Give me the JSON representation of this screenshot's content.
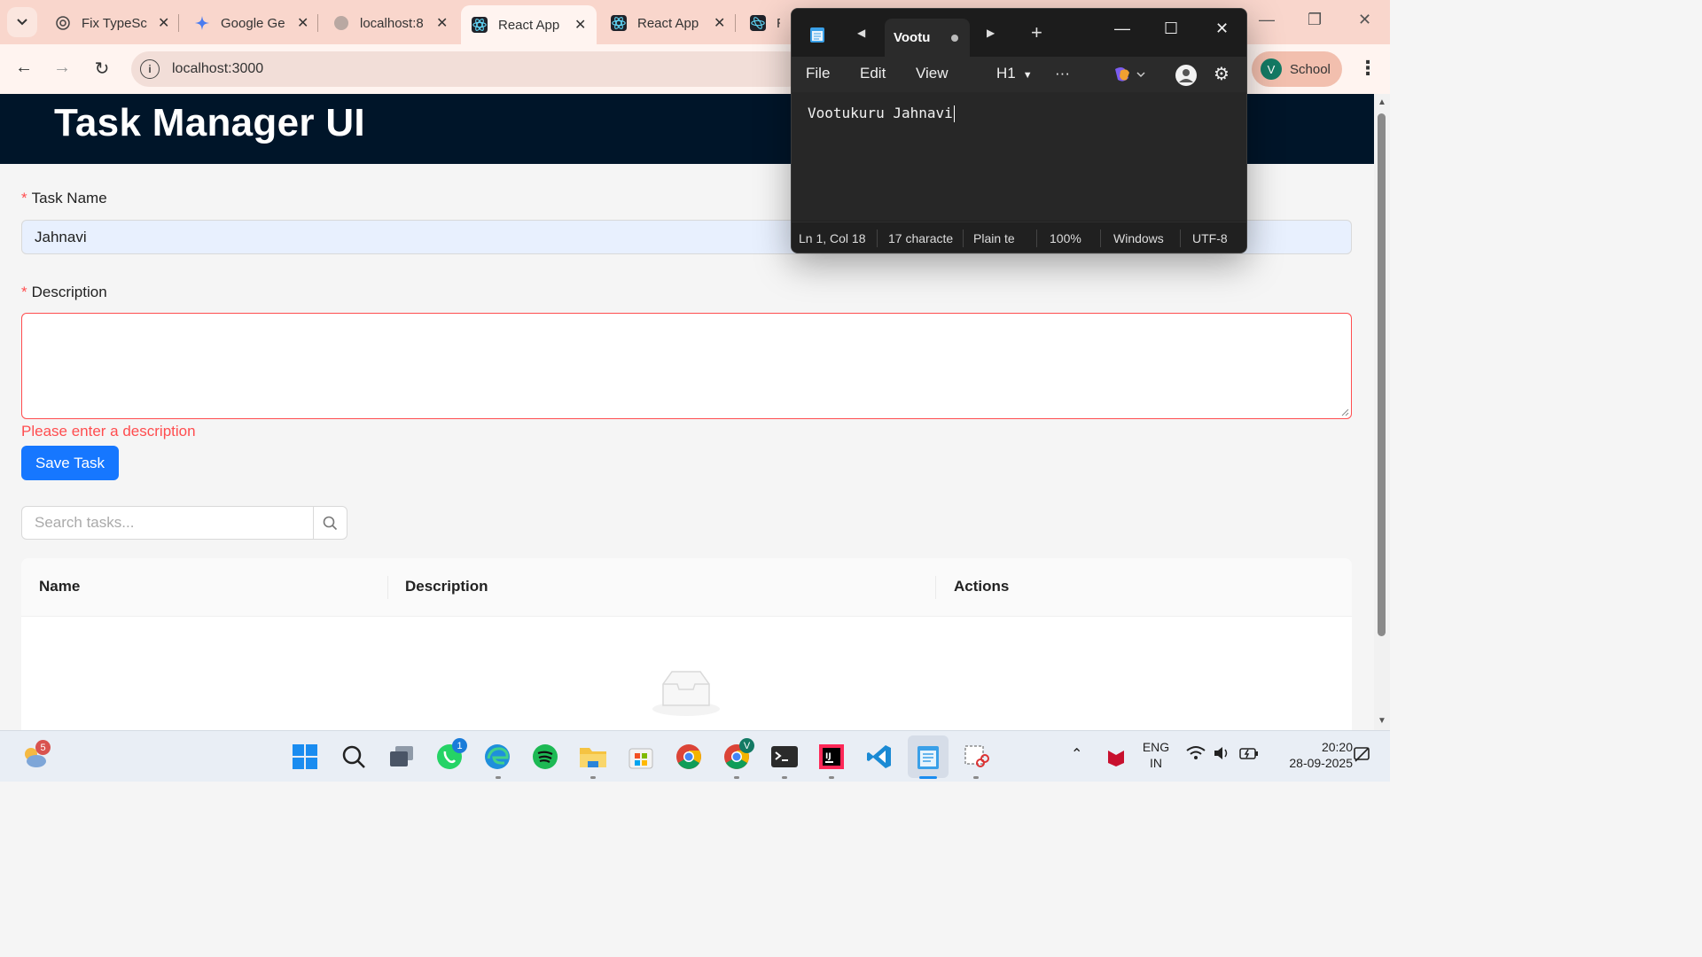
{
  "browser": {
    "tabs": [
      {
        "title": "Fix TypeSc",
        "active": false
      },
      {
        "title": "Google Ge",
        "active": false
      },
      {
        "title": "localhost:8",
        "active": false
      },
      {
        "title": "React App",
        "active": true
      },
      {
        "title": "React App",
        "active": false
      },
      {
        "title": "Rea",
        "active": false
      }
    ],
    "close_glyph": "✕",
    "url": "localhost:3000",
    "profile_initial": "V",
    "profile_name": "School"
  },
  "app": {
    "title": "Task Manager UI",
    "task_name_label": "Task Name",
    "task_name_value": "Jahnavi",
    "description_label": "Description",
    "description_value": "",
    "description_error": "Please enter a description",
    "required_mark": "*",
    "save_button": "Save Task",
    "search_placeholder": "Search tasks...",
    "table_headers": [
      "Name",
      "Description",
      "Actions"
    ]
  },
  "notepad": {
    "tab_title": "Vootu",
    "menu": [
      "File",
      "Edit",
      "View"
    ],
    "heading_dropdown": "H1",
    "more": "···",
    "content": "Vootukuru Jahnavi",
    "status": {
      "position": "Ln 1, Col 18",
      "characters": "17 characte",
      "format": "Plain te",
      "zoom": "100%",
      "line_ending": "Windows",
      "encoding": "UTF-8"
    }
  },
  "taskbar": {
    "weather_badge": "5",
    "whatsapp_badge": "1",
    "chrome_profile_badge": "V",
    "language_line1": "ENG",
    "language_line2": "IN",
    "time": "20:20",
    "date": "28-09-2025"
  },
  "colors": {
    "header_bg": "#001529",
    "primary": "#1677ff",
    "error": "#ff4d4f",
    "tabstrip": "#f9d6cc"
  }
}
